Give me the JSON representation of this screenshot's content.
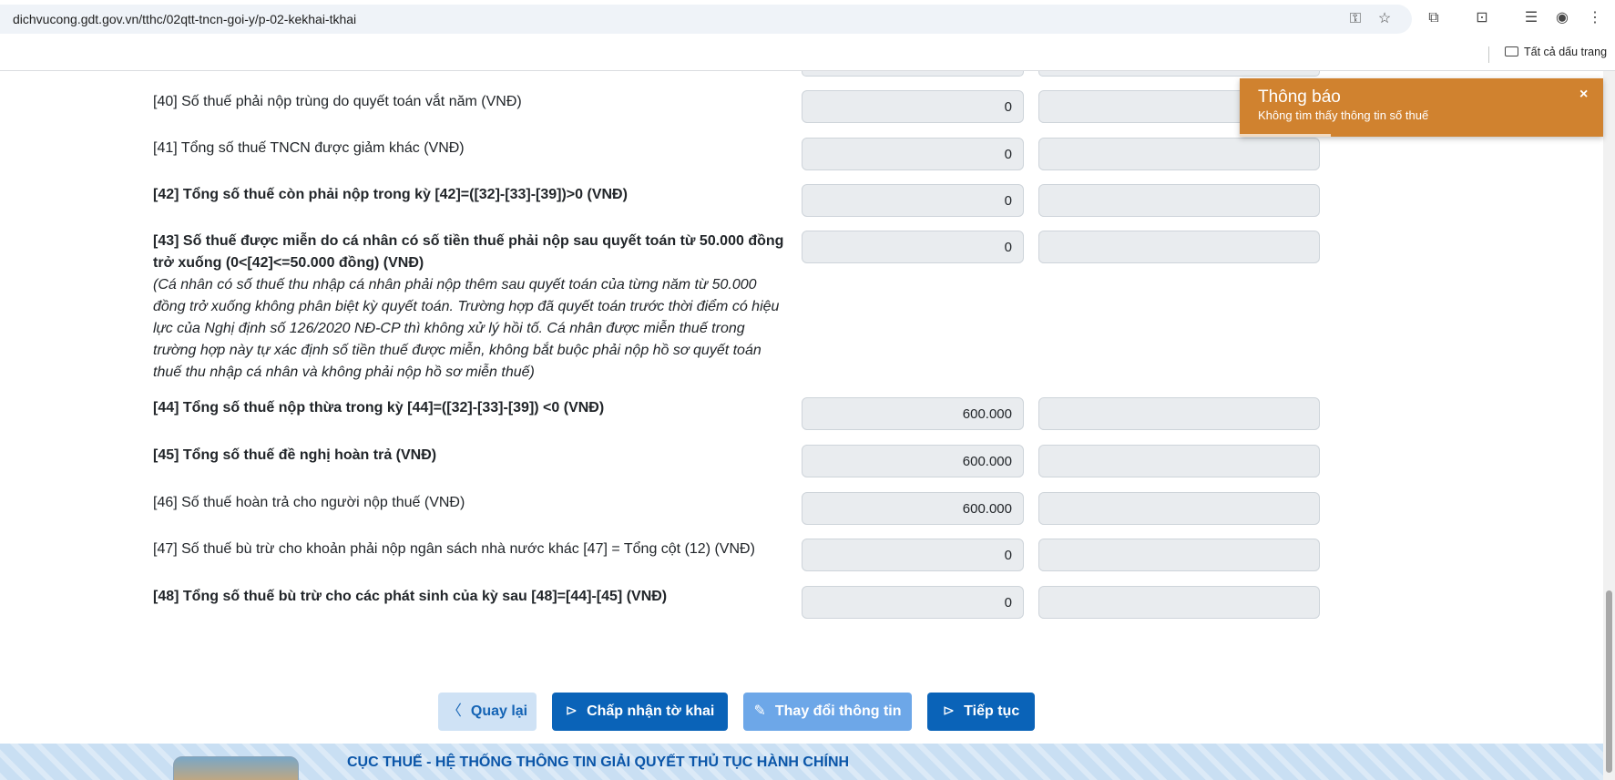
{
  "browser": {
    "url": "dichvucong.gdt.gov.vn/tthc/02qtt-tncn-goi-y/p-02-kekhai-tkhai",
    "bookmarks_all": "Tất cả dấu trang"
  },
  "form": {
    "rows": [
      {
        "label": "[40] Số thuế phải nộp trùng do quyết toán vắt năm (VNĐ)",
        "value": "0"
      },
      {
        "label": "[41] Tổng số thuế TNCN được giảm khác (VNĐ)",
        "value": "0"
      },
      {
        "label": "[42] Tổng số thuế còn phải nộp trong kỳ [42]=([32]-[33]-[39])>0 (VNĐ)",
        "value": "0"
      },
      {
        "label": "[43] Số thuế được miễn do cá nhân có số tiền thuế phải nộp sau quyết toán từ 50.000 đồng trở xuống (0<[42]<=50.000 đồng) (VNĐ)",
        "value": "0",
        "note": "(Cá nhân có số thuế thu nhập cá nhân phải nộp thêm sau quyết toán của từng năm từ 50.000 đồng trở xuống không phân biệt kỳ quyết toán. Trường hợp đã quyết toán trước thời điểm có hiệu lực của Nghị định số 126/2020 NĐ-CP thì không xử lý hồi tố. Cá nhân được miễn thuế trong trường hợp này tự xác định số tiền thuế được miễn, không bắt buộc phải nộp hồ sơ quyết toán thuế thu nhập cá nhân và không phải nộp hồ sơ miễn thuế)"
      },
      {
        "label": "[44] Tổng số thuế nộp thừa trong kỳ [44]=([32]-[33]-[39]) <0 (VNĐ)",
        "value": "600.000"
      },
      {
        "label": "[45] Tổng số thuế đề nghị hoàn trả (VNĐ)",
        "value": "600.000"
      },
      {
        "label": "[46] Số thuế hoàn trả cho người nộp thuế (VNĐ)",
        "value": "600.000"
      },
      {
        "label": "[47] Số thuế bù trừ cho khoản phải nộp ngân sách nhà nước khác [47] = Tổng cột (12) (VNĐ)",
        "value": "0"
      },
      {
        "label": "[48] Tổng số thuế bù trừ cho các phát sinh của kỳ sau [48]=[44]-[45] (VNĐ)",
        "value": "0"
      }
    ]
  },
  "buttons": {
    "back": "Quay lại",
    "accept": "Chấp nhận tờ khai",
    "change": "Thay đổi thông tin",
    "next": "Tiếp tục"
  },
  "footer": {
    "title": "CỤC THUẾ - HỆ THỐNG THÔNG TIN GIẢI QUYẾT THỦ TỤC HÀNH CHÍNH"
  },
  "toast": {
    "title": "Thông báo",
    "message": "Không tìm thấy thông tin số thuế",
    "close": "×"
  },
  "colors": {
    "toast": "#d0822f",
    "primary_button": "#0a63b8",
    "footer_title": "#0a55a8"
  }
}
